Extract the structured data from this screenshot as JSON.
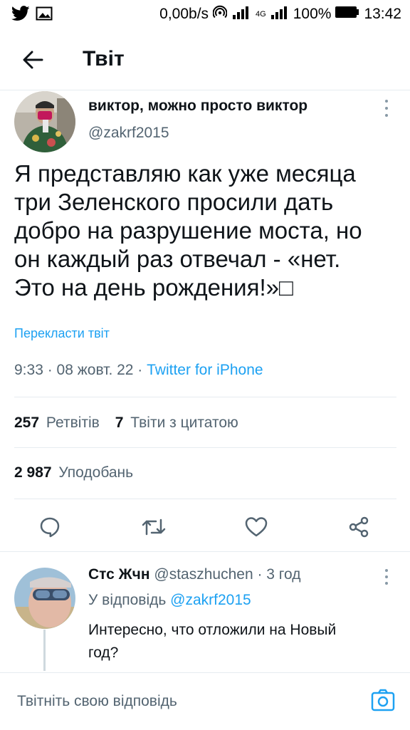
{
  "status_bar": {
    "network_speed": "0,00b/s",
    "network_type": "4G",
    "battery": "100%",
    "time": "13:42",
    "icons": [
      "twitter-icon",
      "image-icon",
      "hotspot-icon",
      "signal-icon",
      "battery-icon"
    ]
  },
  "header": {
    "title": "Твіт",
    "back_icon": "arrow-left-icon"
  },
  "tweet": {
    "author_name": "виктор, можно просто виктор",
    "author_handle": "@zakrf2015",
    "text_lines": [
      "Я представляю как уже месяца",
      "три Зеленского просили дать",
      "добро на разрушение моста, но",
      "он каждый раз отвечал - «нет.",
      "Это на день рождения!»□"
    ],
    "translate_label": "Перекласти твіт",
    "date": "9:33 · 08 жовт. 22 · ",
    "source": "Twitter for iPhone",
    "retweets_count": "257",
    "retweets_label": "Ретвітів",
    "quotes_count": "7",
    "quotes_label": "Твіти з цитатою",
    "likes_count": "2 987",
    "likes_label": "Уподобань"
  },
  "reply": {
    "author_name": "Стс Жчн",
    "author_handle": "@staszhuchen",
    "time": "· 3 год",
    "reply_to_label": "У відповідь",
    "reply_to_handle": "@zakrf2015",
    "text_lines": [
      "Интересно, что отложили на Новый",
      "год?"
    ]
  },
  "composer": {
    "placeholder": "Твітніть свою відповідь",
    "camera_icon": "camera-icon"
  },
  "colors": {
    "accent": "#1da1f2",
    "secondary_text": "#536471",
    "divider": "#e6ecf0"
  }
}
